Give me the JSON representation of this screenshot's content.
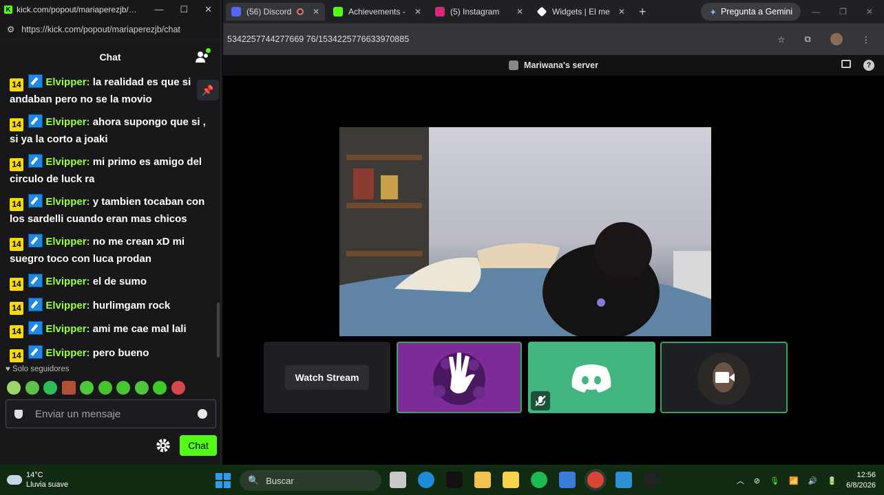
{
  "popout": {
    "title": "kick.com/popout/mariaperezjb/…",
    "url": "https://kick.com/popout/mariaperezjb/chat",
    "header": "Chat",
    "messages": [
      {
        "badge": "14",
        "user": "Elvipper",
        "text": "la realidad es que si andaban pero no se la movio"
      },
      {
        "badge": "14",
        "user": "Elvipper",
        "text": "ahora supongo que si , si ya la corto a joaki"
      },
      {
        "badge": "14",
        "user": "Elvipper",
        "text": "mi primo es amigo del circulo de luck ra"
      },
      {
        "badge": "14",
        "user": "Elvipper",
        "text": "y tambien tocaban con los sardelli cuando eran mas chicos"
      },
      {
        "badge": "14",
        "user": "Elvipper",
        "text": "no me crean xD mi suegro toco con luca prodan"
      },
      {
        "badge": "14",
        "user": "Elvipper",
        "text": "el de sumo"
      },
      {
        "badge": "14",
        "user": "Elvipper",
        "text": "hurlimgam rock"
      },
      {
        "badge": "14",
        "user": "Elvipper",
        "text": "ami me cae mal lali"
      },
      {
        "badge": "14",
        "user": "Elvipper",
        "text": "pero bueno"
      }
    ],
    "followers_mode": "Solo seguidores",
    "input_placeholder": "Enviar un mensaje",
    "send_label": "Chat"
  },
  "browser": {
    "tabs": [
      {
        "label": "(56) Discord",
        "color": "#5865f2"
      },
      {
        "label": "Achievements -",
        "color": "#53fc18"
      },
      {
        "label": "(5) Instagram",
        "color": "#d62976"
      },
      {
        "label": "Widgets | El me",
        "color": "#ffffff"
      }
    ],
    "gemini_label": "Pregunta a Gemini",
    "address": "5342257744277669 76/1534225776633970885",
    "server_name": "Mariwana's server",
    "watch_stream_label": "Watch Stream"
  },
  "taskbar": {
    "temperature": "14°C",
    "weather_desc": "Lluvia suave",
    "search_placeholder": "Buscar",
    "time": "12:56",
    "date": "6/8/2026"
  },
  "colors": {
    "kick_green": "#53fc18",
    "discord_green": "#43b581",
    "accent_purple": "#7c2b98"
  }
}
